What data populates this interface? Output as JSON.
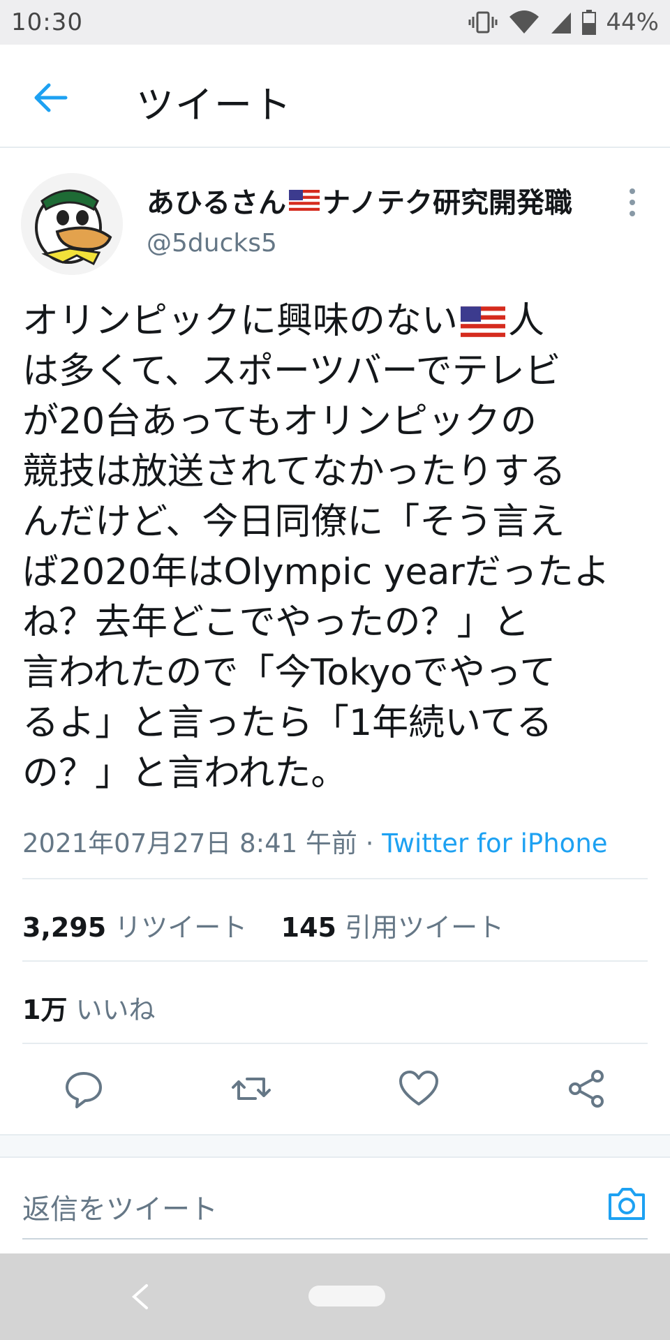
{
  "status_bar": {
    "time": "10:30",
    "battery": "44%",
    "icons": [
      "vibrate-icon",
      "wifi-icon",
      "signal-icon",
      "battery-icon"
    ]
  },
  "header": {
    "title": "ツイート",
    "back_icon": "arrow-left-icon"
  },
  "tweet": {
    "author_name_prefix": "あひるさん",
    "author_name_suffix": "ナノテク研究開発職",
    "author_handle": "@5ducks5",
    "text_lines": [
      [
        "オリンピックに興味のない",
        "flag",
        "人"
      ],
      [
        "は多くて、スポーツバーでテレビ"
      ],
      [
        "が20台あってもオリンピックの"
      ],
      [
        "競技は放送されてなかったりする"
      ],
      [
        "んだけど、今日同僚に「そう言え"
      ],
      [
        "ば2020年はOlympic yearだったよ"
      ],
      [
        "ね？去年どこでやったの？」と"
      ],
      [
        "言われたので「今Tokyoでやって"
      ],
      [
        "るよ」と言ったら「1年続いてる"
      ],
      [
        "の？」と言われた。"
      ]
    ],
    "timestamp": "2021年07月27日 8:41 午前",
    "separator": " · ",
    "source": "Twitter for iPhone"
  },
  "stats": {
    "retweets_count": "3,295",
    "retweets_label": "リツイート",
    "quotes_count": "145",
    "quotes_label": "引用ツイート",
    "likes_count": "1万",
    "likes_label": "いいね"
  },
  "actions": [
    "reply-icon",
    "retweet-icon",
    "like-icon",
    "share-icon"
  ],
  "reply": {
    "placeholder": "返信をツイート",
    "camera_icon": "camera-icon"
  },
  "colors": {
    "accent": "#1da1f2",
    "text": "#14171a",
    "secondary": "#657786",
    "divider": "#e6ecf0"
  }
}
